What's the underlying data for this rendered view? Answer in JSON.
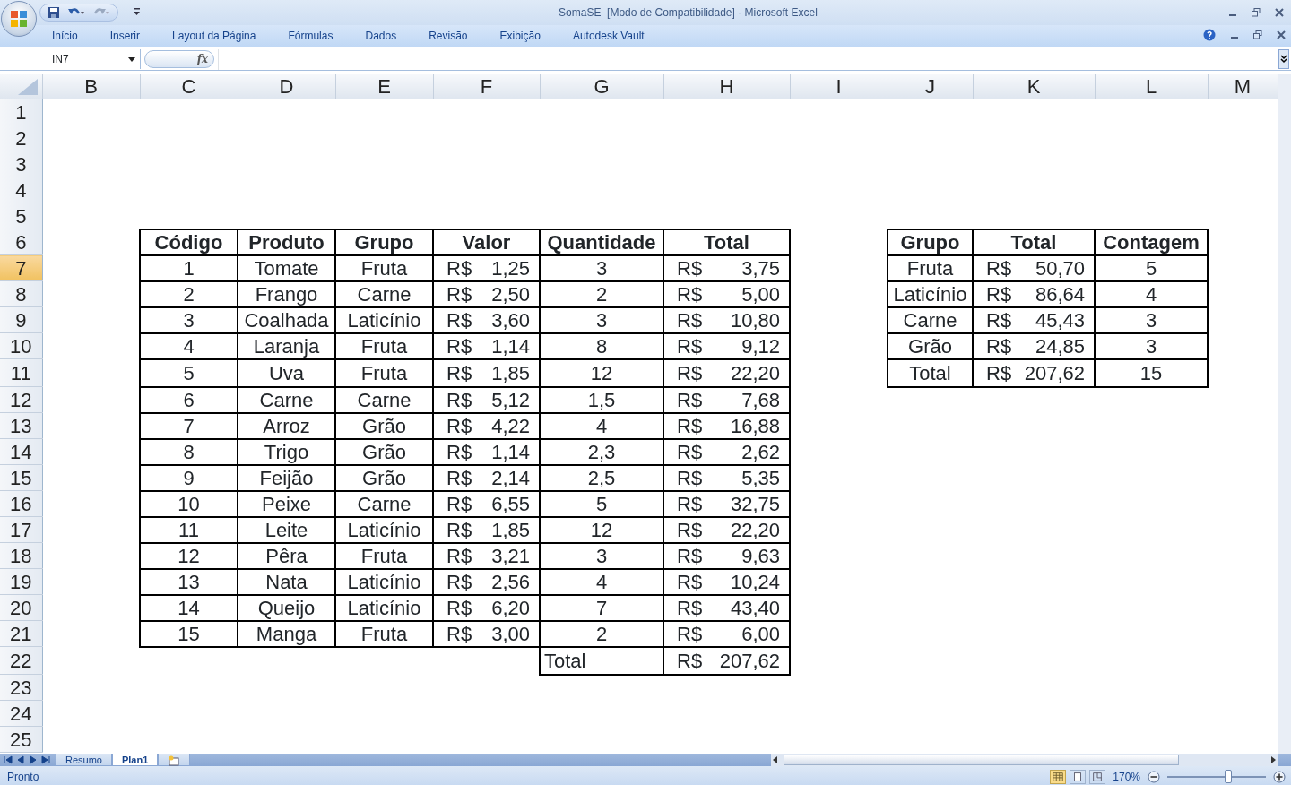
{
  "window": {
    "title": "SomaSE  [Modo de Compatibilidade] - Microsoft Excel"
  },
  "ribbon_tabs": [
    {
      "label": "Início",
      "selected": false
    },
    {
      "label": "Inserir",
      "selected": false
    },
    {
      "label": "Layout da Página",
      "selected": false
    },
    {
      "label": "Fórmulas",
      "selected": false
    },
    {
      "label": "Dados",
      "selected": false
    },
    {
      "label": "Revisão",
      "selected": false
    },
    {
      "label": "Exibição",
      "selected": false
    },
    {
      "label": "Autodesk Vault",
      "selected": false
    }
  ],
  "name_box": {
    "value": "IN7"
  },
  "formula_bar": {
    "function_button": "fx"
  },
  "columns": [
    {
      "label": "B",
      "selected": false
    },
    {
      "label": "C",
      "selected": false
    },
    {
      "label": "D",
      "selected": false
    },
    {
      "label": "E",
      "selected": false
    },
    {
      "label": "F",
      "selected": false
    },
    {
      "label": "G",
      "selected": false
    },
    {
      "label": "H",
      "selected": false
    },
    {
      "label": "I",
      "selected": false
    },
    {
      "label": "J",
      "selected": false
    },
    {
      "label": "K",
      "selected": false
    },
    {
      "label": "L",
      "selected": false
    },
    {
      "label": "M",
      "selected": false
    }
  ],
  "rows": [
    {
      "label": "1",
      "selected": false
    },
    {
      "label": "2",
      "selected": false
    },
    {
      "label": "3",
      "selected": false
    },
    {
      "label": "4",
      "selected": false
    },
    {
      "label": "5",
      "selected": false
    },
    {
      "label": "6",
      "selected": false
    },
    {
      "label": "7",
      "selected": true
    },
    {
      "label": "8",
      "selected": false
    },
    {
      "label": "9",
      "selected": false
    },
    {
      "label": "10",
      "selected": false
    },
    {
      "label": "11",
      "selected": false
    },
    {
      "label": "12",
      "selected": false
    },
    {
      "label": "13",
      "selected": false
    },
    {
      "label": "14",
      "selected": false
    },
    {
      "label": "15",
      "selected": false
    },
    {
      "label": "16",
      "selected": false
    },
    {
      "label": "17",
      "selected": false
    },
    {
      "label": "18",
      "selected": false
    },
    {
      "label": "19",
      "selected": false
    },
    {
      "label": "20",
      "selected": false
    },
    {
      "label": "21",
      "selected": false
    },
    {
      "label": "22",
      "selected": false
    },
    {
      "label": "23",
      "selected": false
    },
    {
      "label": "24",
      "selected": false
    },
    {
      "label": "25",
      "selected": false
    }
  ],
  "main_table": {
    "columns": [
      "Código",
      "Produto",
      "Grupo",
      "Valor",
      "Quantidade",
      "Total"
    ],
    "rows": [
      {
        "code": "1",
        "product": "Tomate",
        "group": "Fruta",
        "price": {
          "currency": "R$",
          "amount": "1,25"
        },
        "quantity": "3",
        "total": {
          "currency": "R$",
          "amount": "3,75"
        }
      },
      {
        "code": "2",
        "product": "Frango",
        "group": "Carne",
        "price": {
          "currency": "R$",
          "amount": "2,50"
        },
        "quantity": "2",
        "total": {
          "currency": "R$",
          "amount": "5,00"
        }
      },
      {
        "code": "3",
        "product": "Coalhada",
        "group": "Laticínio",
        "price": {
          "currency": "R$",
          "amount": "3,60"
        },
        "quantity": "3",
        "total": {
          "currency": "R$",
          "amount": "10,80"
        }
      },
      {
        "code": "4",
        "product": "Laranja",
        "group": "Fruta",
        "price": {
          "currency": "R$",
          "amount": "1,14"
        },
        "quantity": "8",
        "total": {
          "currency": "R$",
          "amount": "9,12"
        }
      },
      {
        "code": "5",
        "product": "Uva",
        "group": "Fruta",
        "price": {
          "currency": "R$",
          "amount": "1,85"
        },
        "quantity": "12",
        "total": {
          "currency": "R$",
          "amount": "22,20"
        }
      },
      {
        "code": "6",
        "product": "Carne",
        "group": "Carne",
        "price": {
          "currency": "R$",
          "amount": "5,12"
        },
        "quantity": "1,5",
        "total": {
          "currency": "R$",
          "amount": "7,68"
        }
      },
      {
        "code": "7",
        "product": "Arroz",
        "group": "Grão",
        "price": {
          "currency": "R$",
          "amount": "4,22"
        },
        "quantity": "4",
        "total": {
          "currency": "R$",
          "amount": "16,88"
        }
      },
      {
        "code": "8",
        "product": "Trigo",
        "group": "Grão",
        "price": {
          "currency": "R$",
          "amount": "1,14"
        },
        "quantity": "2,3",
        "total": {
          "currency": "R$",
          "amount": "2,62"
        }
      },
      {
        "code": "9",
        "product": "Feijão",
        "group": "Grão",
        "price": {
          "currency": "R$",
          "amount": "2,14"
        },
        "quantity": "2,5",
        "total": {
          "currency": "R$",
          "amount": "5,35"
        }
      },
      {
        "code": "10",
        "product": "Peixe",
        "group": "Carne",
        "price": {
          "currency": "R$",
          "amount": "6,55"
        },
        "quantity": "5",
        "total": {
          "currency": "R$",
          "amount": "32,75"
        }
      },
      {
        "code": "11",
        "product": "Leite",
        "group": "Laticínio",
        "price": {
          "currency": "R$",
          "amount": "1,85"
        },
        "quantity": "12",
        "total": {
          "currency": "R$",
          "amount": "22,20"
        }
      },
      {
        "code": "12",
        "product": "Pêra",
        "group": "Fruta",
        "price": {
          "currency": "R$",
          "amount": "3,21"
        },
        "quantity": "3",
        "total": {
          "currency": "R$",
          "amount": "9,63"
        }
      },
      {
        "code": "13",
        "product": "Nata",
        "group": "Laticínio",
        "price": {
          "currency": "R$",
          "amount": "2,56"
        },
        "quantity": "4",
        "total": {
          "currency": "R$",
          "amount": "10,24"
        }
      },
      {
        "code": "14",
        "product": "Queijo",
        "group": "Laticínio",
        "price": {
          "currency": "R$",
          "amount": "6,20"
        },
        "quantity": "7",
        "total": {
          "currency": "R$",
          "amount": "43,40"
        }
      },
      {
        "code": "15",
        "product": "Manga",
        "group": "Fruta",
        "price": {
          "currency": "R$",
          "amount": "3,00"
        },
        "quantity": "2",
        "total": {
          "currency": "R$",
          "amount": "6,00"
        }
      }
    ],
    "total": {
      "label": "Total",
      "value": {
        "currency": "R$",
        "amount": "207,62"
      }
    }
  },
  "summary_table": {
    "columns": [
      "Grupo",
      "Total",
      "Contagem"
    ],
    "rows": [
      {
        "group": "Fruta",
        "total": {
          "currency": "R$",
          "amount": "50,70"
        },
        "count": "5"
      },
      {
        "group": "Laticínio",
        "total": {
          "currency": "R$",
          "amount": "86,64"
        },
        "count": "4"
      },
      {
        "group": "Carne",
        "total": {
          "currency": "R$",
          "amount": "45,43"
        },
        "count": "3"
      },
      {
        "group": "Grão",
        "total": {
          "currency": "R$",
          "amount": "24,85"
        },
        "count": "3"
      }
    ],
    "total": {
      "label": "Total",
      "value": {
        "currency": "R$",
        "amount": "207,62"
      },
      "count": "15"
    }
  },
  "sheet_tabs": [
    {
      "label": "Resumo",
      "selected": false
    },
    {
      "label": "Plan1",
      "selected": true
    }
  ],
  "status_bar": {
    "text": "Pronto",
    "views": [
      {
        "kind": "normal",
        "selected": true
      },
      {
        "kind": "page_layout",
        "selected": false
      },
      {
        "kind": "page_break",
        "selected": false
      }
    ],
    "zoom": "170%",
    "zoom_slider": {
      "level": 0.62
    }
  }
}
